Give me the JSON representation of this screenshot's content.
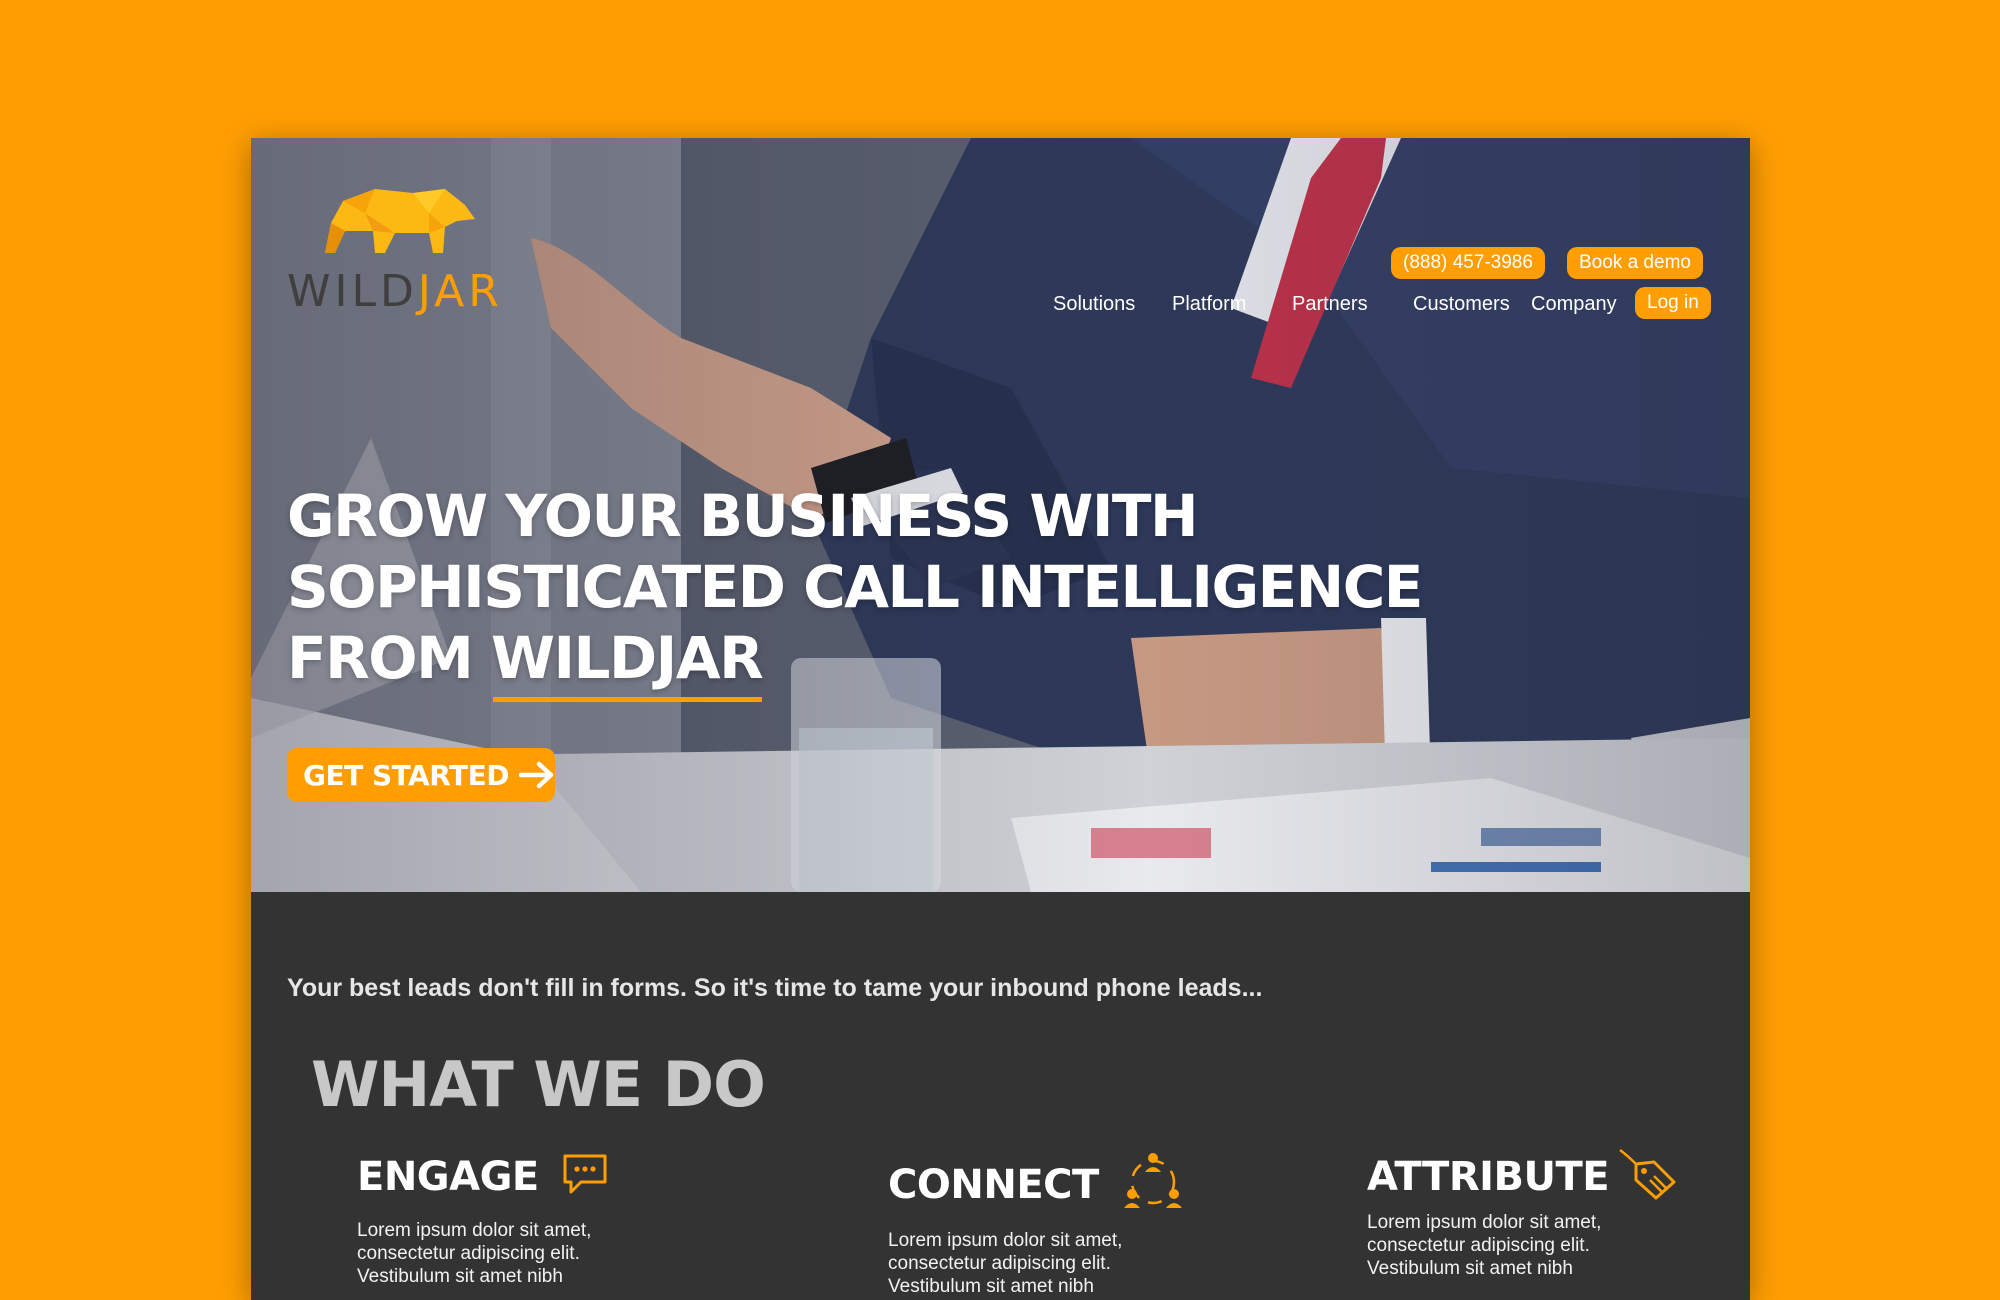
{
  "brand": {
    "logo_wild": "WILD",
    "logo_jar": "JAR",
    "accent_color": "#FF9E03",
    "dark_color": "#333333"
  },
  "header": {
    "phone": "(888) 457-3986",
    "book_demo": "Book a demo",
    "login": "Log in",
    "nav": [
      "Solutions",
      "Platform",
      "Partners",
      "Customers",
      "Company"
    ]
  },
  "hero": {
    "headline_line1": "GROW YOUR BUSINESS WITH",
    "headline_line2": "SOPHISTICATED CALL INTELLIGENCE",
    "headline_line3_prefix": "FROM ",
    "headline_line3_highlight": "WILDJAR",
    "cta_label": "GET STARTED",
    "cta_icon": "arrow-right-icon"
  },
  "intro": {
    "tagline": "Your best leads don't fill in forms. So it's time to tame your inbound phone leads...",
    "section_title": "WHAT WE DO"
  },
  "features": [
    {
      "title": "ENGAGE",
      "icon": "chat-bubble-icon",
      "body_lines": [
        "Lorem ipsum dolor sit amet,",
        "consectetur adipiscing elit.",
        "Vestibulum sit amet nibh"
      ]
    },
    {
      "title": "CONNECT",
      "icon": "network-people-icon",
      "body_lines": [
        "Lorem ipsum dolor sit amet,",
        "consectetur adipiscing elit.",
        "Vestibulum sit amet nibh"
      ]
    },
    {
      "title": "ATTRIBUTE",
      "icon": "price-tag-icon",
      "body_lines": [
        "Lorem ipsum dolor sit amet,",
        "consectetur adipiscing elit.",
        "Vestibulum sit amet nibh"
      ]
    }
  ]
}
